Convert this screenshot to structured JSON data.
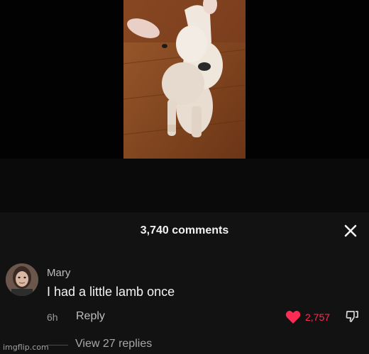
{
  "comments_header": {
    "count_label": "3,740 comments"
  },
  "comment": {
    "author": "Mary",
    "text": "I had a little lamb once",
    "time": "6h",
    "reply_label": "Reply",
    "like_count": "2,757",
    "view_replies_label": "View 27 replies"
  },
  "watermark": "imgflip.com",
  "icons": {
    "close": "close-icon",
    "like": "heart-icon",
    "dislike": "thumbs-down-icon"
  },
  "colors": {
    "sheet_background": "#121212",
    "like_accent": "#fe2c55"
  }
}
